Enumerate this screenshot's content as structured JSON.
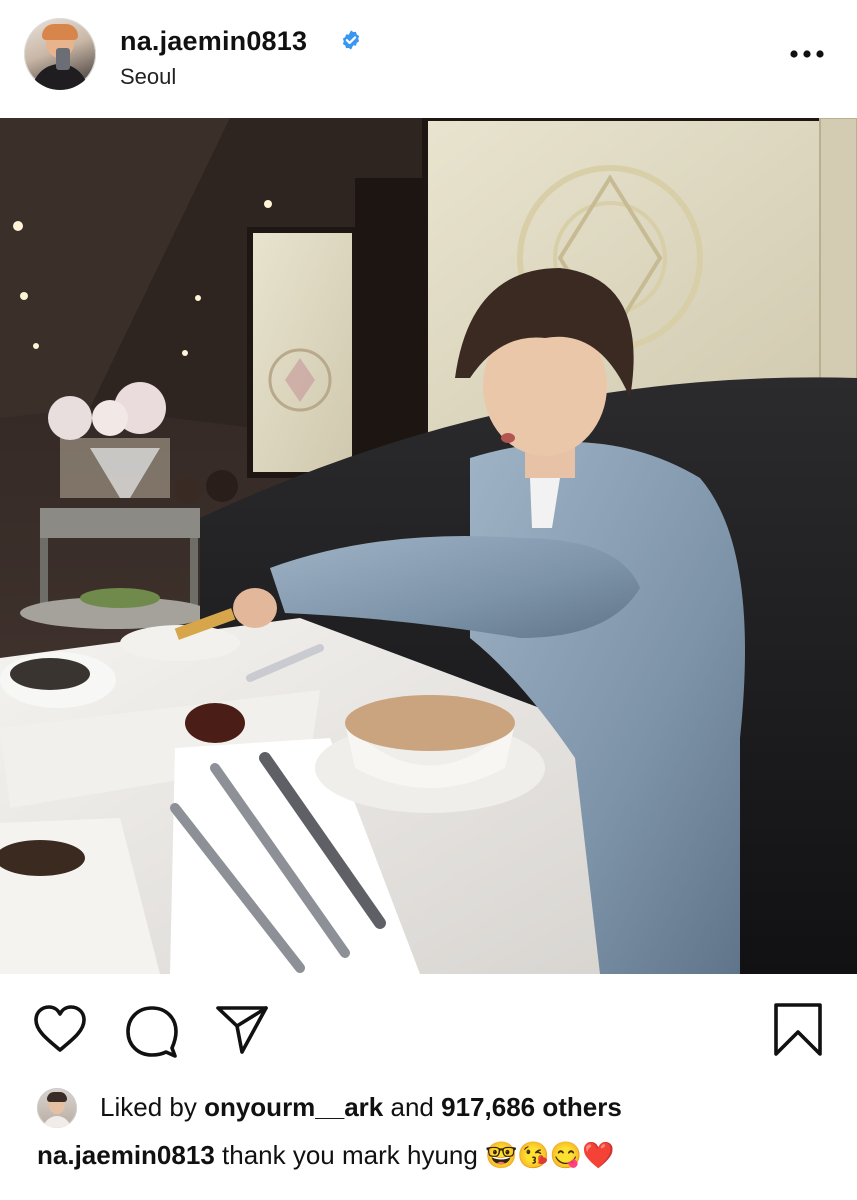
{
  "post": {
    "username": "na.jaemin0813",
    "verified": true,
    "location": "Seoul"
  },
  "icons": {
    "more": "more-options-icon",
    "like": "heart-icon",
    "comment": "comment-icon",
    "share": "send-icon",
    "save": "bookmark-icon",
    "verified": "verified-badge-icon"
  },
  "colors": {
    "verified_blue": "#3897f0",
    "text": "#111111",
    "heart_red": "#e0245e"
  },
  "likes": {
    "prefix": "Liked by",
    "liker": "onyourm__ark",
    "middle": "and",
    "count_text": "917,686 others"
  },
  "caption": {
    "username": "na.jaemin0813",
    "text": "thank you mark hyung",
    "emojis": "🤓😘😋❤️"
  }
}
